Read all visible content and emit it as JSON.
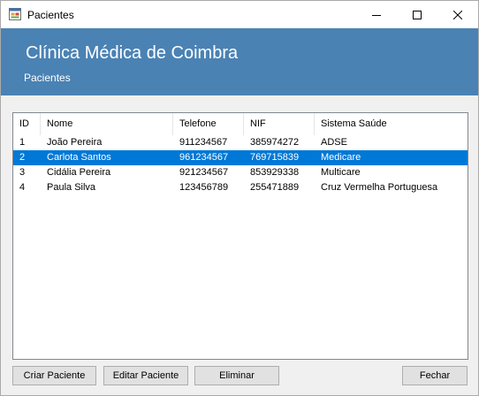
{
  "window": {
    "title": "Pacientes"
  },
  "header": {
    "title": "Clínica Médica de Coimbra",
    "subtitle": "Pacientes"
  },
  "table": {
    "columns": [
      "ID",
      "Nome",
      "Telefone",
      "NIF",
      "Sistema Saúde"
    ],
    "rows": [
      [
        "1",
        "João Pereira",
        "911234567",
        "385974272",
        "ADSE"
      ],
      [
        "2",
        "Carlota Santos",
        "961234567",
        "769715839",
        "Medicare"
      ],
      [
        "3",
        "Cidália Pereira",
        "921234567",
        "853929338",
        "Multicare"
      ],
      [
        "4",
        "Paula Silva",
        "123456789",
        "255471889",
        "Cruz Vermelha Portuguesa"
      ]
    ],
    "selected_row": 2
  },
  "buttons": {
    "create": "Criar Paciente",
    "edit": "Editar Paciente",
    "delete": "Eliminar",
    "close": "Fechar"
  },
  "colors": {
    "header_bg": "#4a82b4",
    "selection": "#0078d7"
  },
  "icons": {
    "app": "form-window-icon",
    "minimize": "minimize-icon",
    "maximize": "maximize-icon",
    "close": "close-icon"
  }
}
